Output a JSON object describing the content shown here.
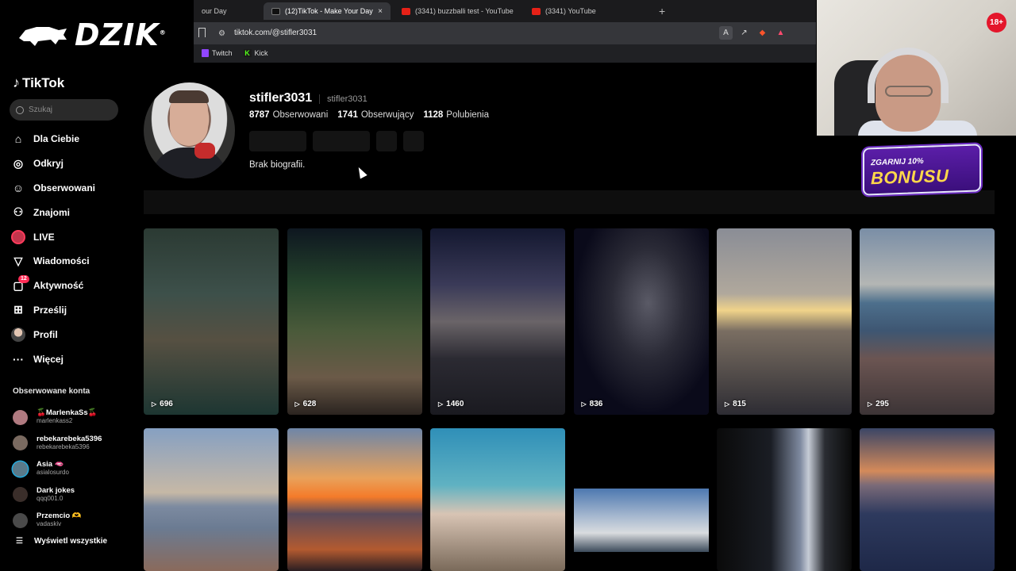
{
  "browser": {
    "tabs": [
      {
        "label": "our Day",
        "favicon": "tiktok",
        "active": false
      },
      {
        "label": "(12)TikTok - Make Your Day",
        "favicon": "tiktok",
        "active": true,
        "close": "×"
      },
      {
        "label": "(3341) buzzballi test - YouTube",
        "favicon": "youtube",
        "active": false
      },
      {
        "label": "(3341) YouTube",
        "favicon": "youtube",
        "active": false
      }
    ],
    "new_tab": "+",
    "url": "tiktok.com/@stifler3031",
    "bookmarks": [
      "Twitch",
      "Kick"
    ]
  },
  "overlay": {
    "logo_text": "DZIK",
    "logo_mark": "®",
    "age_badge": "18+",
    "bonus_top": "ZGARNIJ 10%",
    "bonus_main": "BONUSU"
  },
  "sidebar": {
    "logo": "TikTok",
    "search_placeholder": "Szukaj",
    "nav": [
      {
        "label": "Dla Ciebie",
        "icon": "home-icon"
      },
      {
        "label": "Odkryj",
        "icon": "compass-icon"
      },
      {
        "label": "Obserwowani",
        "icon": "following-icon"
      },
      {
        "label": "Znajomi",
        "icon": "friends-icon"
      },
      {
        "label": "LIVE",
        "icon": "live-icon"
      },
      {
        "label": "Wiadomości",
        "icon": "messages-icon"
      },
      {
        "label": "Aktywność",
        "icon": "activity-icon",
        "badge": "12"
      },
      {
        "label": "Prześlij",
        "icon": "upload-icon"
      },
      {
        "label": "Profil",
        "icon": "profile-icon"
      },
      {
        "label": "Więcej",
        "icon": "more-icon"
      }
    ],
    "followed_title": "Obserwowane konta",
    "followed": [
      {
        "name": "🍒MarlenkaSs🍒",
        "user": "marlenkass2",
        "color": "#b07a80"
      },
      {
        "name": "rebekarebeka5396",
        "user": "rebekarebeka5396",
        "color": "#7a6a60"
      },
      {
        "name": "Asia 🫦",
        "user": "asialosurdo",
        "color": "#5a7a8a"
      },
      {
        "name": "Dark jokes",
        "user": "qqq001.0",
        "color": "#3a2e2a"
      },
      {
        "name": "Przemcio 🫶",
        "user": "vadaskiv",
        "color": "#4a4a4a"
      }
    ],
    "show_all": "Wyświetl wszystkie"
  },
  "profile": {
    "username": "stifler3031",
    "handle": "stifler3031",
    "following_count": "8787",
    "following_label": "Obserwowani",
    "followers_count": "1741",
    "followers_label": "Obserwujący",
    "likes_count": "1128",
    "likes_label": "Polubienia",
    "bio": "Brak biografii."
  },
  "videos": [
    {
      "views": "696"
    },
    {
      "views": "628"
    },
    {
      "views": "1460"
    },
    {
      "views": "836"
    },
    {
      "views": "815"
    },
    {
      "views": "295"
    },
    {
      "views": ""
    },
    {
      "views": ""
    },
    {
      "views": ""
    },
    {
      "views": ""
    },
    {
      "views": ""
    },
    {
      "views": ""
    }
  ],
  "colors": {
    "accent": "#fe2c55",
    "background": "#000000",
    "bonus_purple": "#5b1ea8",
    "bonus_yellow": "#ffd84a"
  }
}
